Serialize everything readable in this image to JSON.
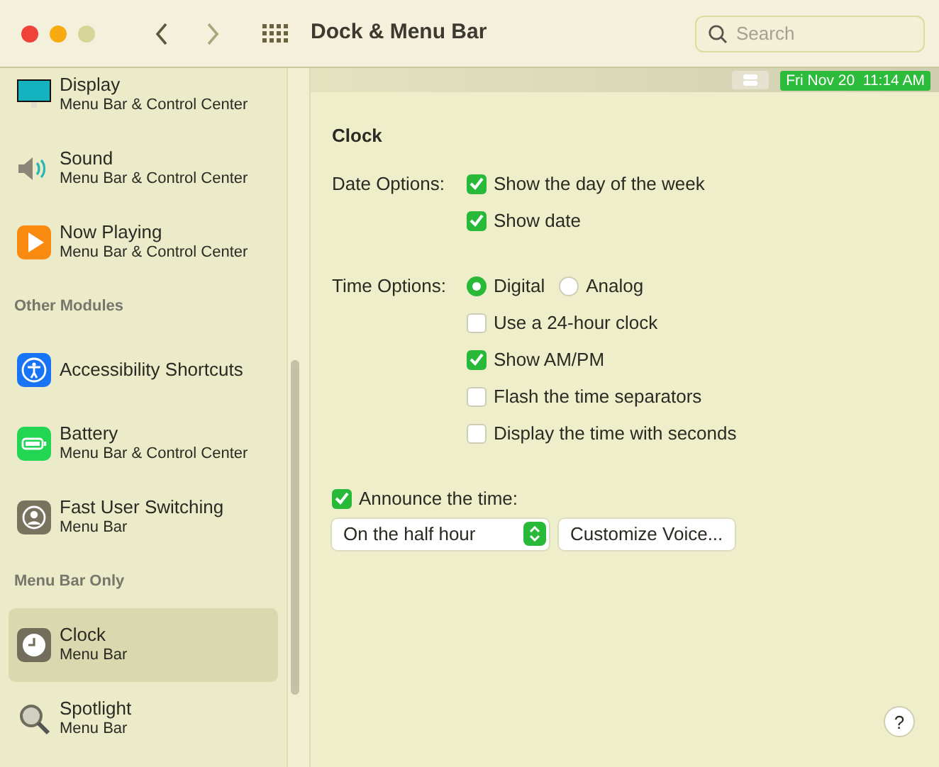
{
  "window": {
    "title": "Dock & Menu Bar"
  },
  "search": {
    "placeholder": "Search"
  },
  "sidebar": {
    "sections": [
      {
        "items": [
          {
            "title": "Display",
            "subtitle": "Menu Bar & Control Center",
            "selected": false
          },
          {
            "title": "Sound",
            "subtitle": "Menu Bar & Control Center",
            "selected": false
          },
          {
            "title": "Now Playing",
            "subtitle": "Menu Bar & Control Center",
            "selected": false
          }
        ]
      },
      {
        "header": "Other Modules",
        "items": [
          {
            "title": "Accessibility Shortcuts",
            "selected": false
          },
          {
            "title": "Battery",
            "subtitle": "Menu Bar & Control Center",
            "selected": false
          },
          {
            "title": "Fast User Switching",
            "subtitle": "Menu Bar",
            "selected": false
          }
        ]
      },
      {
        "header": "Menu Bar Only",
        "items": [
          {
            "title": "Clock",
            "subtitle": "Menu Bar",
            "selected": true
          },
          {
            "title": "Spotlight",
            "subtitle": "Menu Bar",
            "selected": false
          }
        ]
      }
    ]
  },
  "menu_bar_preview": {
    "clock": "Fri Nov 20  11:14 AM"
  },
  "clock": {
    "heading": "Clock",
    "date_options": {
      "label": "Date Options:",
      "checkboxes": [
        {
          "label": "Show the day of the week",
          "checked": true
        },
        {
          "label": "Show date",
          "checked": true
        }
      ]
    },
    "time_options": {
      "label": "Time Options:",
      "radios": [
        {
          "label": "Digital",
          "selected": true
        },
        {
          "label": "Analog",
          "selected": false
        }
      ],
      "checkboxes": [
        {
          "label": "Use a 24-hour clock",
          "checked": false
        },
        {
          "label": "Show AM/PM",
          "checked": true
        },
        {
          "label": "Flash the time separators",
          "checked": false
        },
        {
          "label": "Display the time with seconds",
          "checked": false
        }
      ]
    },
    "announce": {
      "label": "Announce the time:",
      "checked": true
    },
    "interval": {
      "value": "On the half hour"
    },
    "voice_button": "Customize Voice..."
  },
  "help_button": "?"
}
